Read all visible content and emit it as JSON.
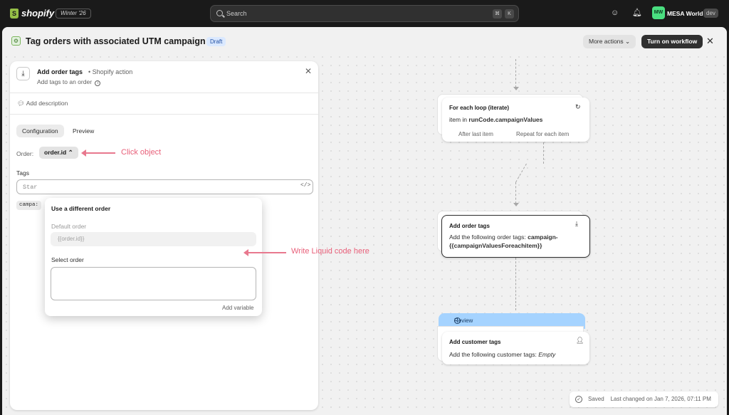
{
  "topbar": {
    "logo_text": "shopify",
    "edition": "Winter '26",
    "search_placeholder": "Search",
    "shortcut_keys": [
      "⌘",
      "K"
    ],
    "store_initials": "MW",
    "store_name": "MESA World",
    "store_badge": "dev"
  },
  "header": {
    "title": "Tag orders with associated UTM campaign",
    "status_badge": "Draft",
    "more_actions_label": "More actions",
    "turn_on_label": "Turn on workflow"
  },
  "panel": {
    "title": "Add order tags",
    "separator": "•",
    "type": "Shopify action",
    "subtitle": "Add tags to an order",
    "add_description_label": "Add description",
    "tabs": [
      {
        "label": "Configuration",
        "active": true
      },
      {
        "label": "Preview",
        "active": false
      }
    ],
    "order_label": "Order:",
    "order_value": "order.id",
    "tags_label": "Tags",
    "tags_input_value": "Star",
    "tag_chip": "campa:"
  },
  "popover": {
    "title": "Use a different order",
    "default_label": "Default order",
    "default_placeholder": "{{order.id}}",
    "select_label": "Select order",
    "select_value": "",
    "add_variable_label": "Add variable"
  },
  "annotations": {
    "click_object": "Click object",
    "write_liquid": "Write Liquid code here"
  },
  "canvas": {
    "loop_node": {
      "title": "For each loop (iterate)",
      "body_prefix": "item in",
      "body_value": "runCode.campaignValues",
      "branch_after": "After last item",
      "branch_repeat": "Repeat for each item"
    },
    "tags_node": {
      "title": "Add order tags",
      "body_prefix": "Add the following order tags:",
      "body_value": "campaign-{{campaignValuesForeachitem}}"
    },
    "review_label": "Review",
    "customer_node": {
      "title": "Add customer tags",
      "body_prefix": "Add the following customer tags:",
      "body_value": "Empty"
    }
  },
  "footer": {
    "saved_label": "Saved",
    "last_changed": "Last changed on Jan 7, 2026, 07:11 PM"
  }
}
